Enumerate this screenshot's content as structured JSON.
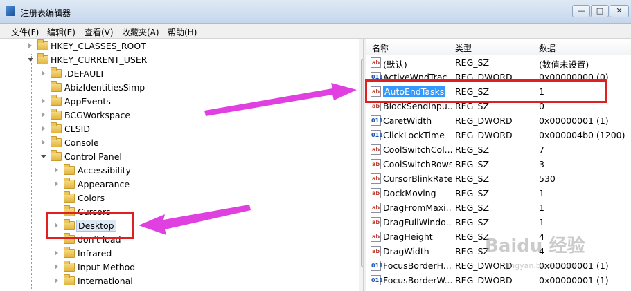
{
  "window": {
    "title": "注册表编辑器",
    "minimize": "—",
    "maximize": "□",
    "close": "✕"
  },
  "menu": [
    "文件(F)",
    "编辑(E)",
    "查看(V)",
    "收藏夹(A)",
    "帮助(H)"
  ],
  "tree": [
    {
      "label": "HKEY_CLASSES_ROOT"
    },
    {
      "label": "HKEY_CURRENT_USER"
    },
    {
      "label": ".DEFAULT"
    },
    {
      "label": "AbizIdentitiesSimp"
    },
    {
      "label": "AppEvents"
    },
    {
      "label": "BCGWorkspace"
    },
    {
      "label": "CLSID"
    },
    {
      "label": "Console"
    },
    {
      "label": "Control Panel"
    },
    {
      "label": "Accessibility"
    },
    {
      "label": "Appearance"
    },
    {
      "label": "Colors"
    },
    {
      "label": "Cursors"
    },
    {
      "label": "Desktop"
    },
    {
      "label": "don't load"
    },
    {
      "label": "Infrared"
    },
    {
      "label": "Input Method"
    },
    {
      "label": "International"
    }
  ],
  "list": {
    "headers": [
      "名称",
      "类型",
      "数据"
    ],
    "rows": [
      {
        "icon": "ab",
        "name": "(默认)",
        "type": "REG_SZ",
        "data": "(数值未设置)"
      },
      {
        "icon": "011",
        "name": "ActiveWndTrac",
        "type": "REG_DWORD",
        "data": "0x00000000 (0)"
      },
      {
        "icon": "ab",
        "name": "AutoEndTasks",
        "type": "REG_SZ",
        "data": "1"
      },
      {
        "icon": "ab",
        "name": "BlockSendInpu...",
        "type": "REG_SZ",
        "data": "0"
      },
      {
        "icon": "011",
        "name": "CaretWidth",
        "type": "REG_DWORD",
        "data": "0x00000001 (1)"
      },
      {
        "icon": "011",
        "name": "ClickLockTime",
        "type": "REG_DWORD",
        "data": "0x000004b0 (1200)"
      },
      {
        "icon": "ab",
        "name": "CoolSwitchCol...",
        "type": "REG_SZ",
        "data": "7"
      },
      {
        "icon": "ab",
        "name": "CoolSwitchRows",
        "type": "REG_SZ",
        "data": "3"
      },
      {
        "icon": "ab",
        "name": "CursorBlinkRate",
        "type": "REG_SZ",
        "data": "530"
      },
      {
        "icon": "ab",
        "name": "DockMoving",
        "type": "REG_SZ",
        "data": "1"
      },
      {
        "icon": "ab",
        "name": "DragFromMaxi...",
        "type": "REG_SZ",
        "data": "1"
      },
      {
        "icon": "ab",
        "name": "DragFullWindo...",
        "type": "REG_SZ",
        "data": "1"
      },
      {
        "icon": "ab",
        "name": "DragHeight",
        "type": "REG_SZ",
        "data": "4"
      },
      {
        "icon": "ab",
        "name": "DragWidth",
        "type": "REG_SZ",
        "data": "4"
      },
      {
        "icon": "011",
        "name": "FocusBorderH...",
        "type": "REG_DWORD",
        "data": "0x00000001 (1)"
      },
      {
        "icon": "011",
        "name": "FocusBorderW...",
        "type": "REG_DWORD",
        "data": "0x00000001 (1)"
      }
    ]
  },
  "watermark": {
    "main": "Baidu 经验",
    "sub": "jingyan.baidu.com"
  },
  "colors": {
    "callout": "#e02020",
    "arrow": "#e040e0",
    "selection": "#3399ff"
  }
}
